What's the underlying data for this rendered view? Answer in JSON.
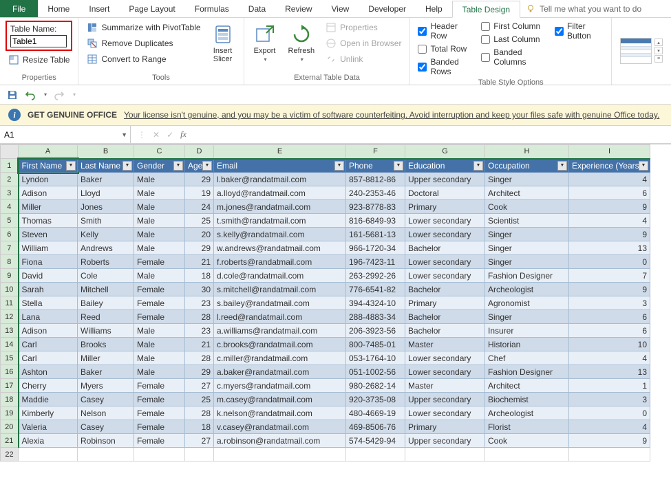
{
  "ribbon": {
    "tabs": [
      "File",
      "Home",
      "Insert",
      "Page Layout",
      "Formulas",
      "Data",
      "Review",
      "View",
      "Developer",
      "Help",
      "Table Design"
    ],
    "active_tab": "Table Design",
    "tellme": "Tell me what you want to do"
  },
  "properties": {
    "label": "Table Name:",
    "value": "Table1",
    "resize": "Resize Table",
    "group_label": "Properties"
  },
  "tools": {
    "pivot": "Summarize with PivotTable",
    "dupes": "Remove Duplicates",
    "convert": "Convert to Range",
    "slicer": "Insert\nSlicer",
    "group_label": "Tools"
  },
  "external": {
    "export": "Export",
    "refresh": "Refresh",
    "props": "Properties",
    "browser": "Open in Browser",
    "unlink": "Unlink",
    "group_label": "External Table Data"
  },
  "styleopts": {
    "header": "Header Row",
    "total": "Total Row",
    "brows": "Banded Rows",
    "fcol": "First Column",
    "lcol": "Last Column",
    "bcols": "Banded Columns",
    "filter": "Filter Button",
    "group_label": "Table Style Options",
    "checked": {
      "header": true,
      "total": false,
      "brows": true,
      "fcol": false,
      "lcol": false,
      "bcols": false,
      "filter": true
    }
  },
  "banner": {
    "title": "GET GENUINE OFFICE",
    "msg": "Your license isn't genuine, and you may be a victim of software counterfeiting. Avoid interruption and keep your files safe with genuine Office today."
  },
  "namebox": "A1",
  "columns": [
    "A",
    "B",
    "C",
    "D",
    "E",
    "F",
    "G",
    "H",
    "I"
  ],
  "table": {
    "headers": [
      "First Name",
      "Last Name",
      "Gender",
      "Age",
      "Email",
      "Phone",
      "Education",
      "Occupation",
      "Experience (Years)"
    ],
    "rows": [
      [
        "Lyndon",
        "Baker",
        "Male",
        "29",
        "l.baker@randatmail.com",
        "857-8812-86",
        "Upper secondary",
        "Singer",
        "4"
      ],
      [
        "Adison",
        "Lloyd",
        "Male",
        "19",
        "a.lloyd@randatmail.com",
        "240-2353-46",
        "Doctoral",
        "Architect",
        "6"
      ],
      [
        "Miller",
        "Jones",
        "Male",
        "24",
        "m.jones@randatmail.com",
        "923-8778-83",
        "Primary",
        "Cook",
        "9"
      ],
      [
        "Thomas",
        "Smith",
        "Male",
        "25",
        "t.smith@randatmail.com",
        "816-6849-93",
        "Lower secondary",
        "Scientist",
        "4"
      ],
      [
        "Steven",
        "Kelly",
        "Male",
        "20",
        "s.kelly@randatmail.com",
        "161-5681-13",
        "Lower secondary",
        "Singer",
        "9"
      ],
      [
        "William",
        "Andrews",
        "Male",
        "29",
        "w.andrews@randatmail.com",
        "966-1720-34",
        "Bachelor",
        "Singer",
        "13"
      ],
      [
        "Fiona",
        "Roberts",
        "Female",
        "21",
        "f.roberts@randatmail.com",
        "196-7423-11",
        "Lower secondary",
        "Singer",
        "0"
      ],
      [
        "David",
        "Cole",
        "Male",
        "18",
        "d.cole@randatmail.com",
        "263-2992-26",
        "Lower secondary",
        "Fashion Designer",
        "7"
      ],
      [
        "Sarah",
        "Mitchell",
        "Female",
        "30",
        "s.mitchell@randatmail.com",
        "776-6541-82",
        "Bachelor",
        "Archeologist",
        "9"
      ],
      [
        "Stella",
        "Bailey",
        "Female",
        "23",
        "s.bailey@randatmail.com",
        "394-4324-10",
        "Primary",
        "Agronomist",
        "3"
      ],
      [
        "Lana",
        "Reed",
        "Female",
        "28",
        "l.reed@randatmail.com",
        "288-4883-34",
        "Bachelor",
        "Singer",
        "6"
      ],
      [
        "Adison",
        "Williams",
        "Male",
        "23",
        "a.williams@randatmail.com",
        "206-3923-56",
        "Bachelor",
        "Insurer",
        "6"
      ],
      [
        "Carl",
        "Brooks",
        "Male",
        "21",
        "c.brooks@randatmail.com",
        "800-7485-01",
        "Master",
        "Historian",
        "10"
      ],
      [
        "Carl",
        "Miller",
        "Male",
        "28",
        "c.miller@randatmail.com",
        "053-1764-10",
        "Lower secondary",
        "Chef",
        "4"
      ],
      [
        "Ashton",
        "Baker",
        "Male",
        "29",
        "a.baker@randatmail.com",
        "051-1002-56",
        "Lower secondary",
        "Fashion Designer",
        "13"
      ],
      [
        "Cherry",
        "Myers",
        "Female",
        "27",
        "c.myers@randatmail.com",
        "980-2682-14",
        "Master",
        "Architect",
        "1"
      ],
      [
        "Maddie",
        "Casey",
        "Female",
        "25",
        "m.casey@randatmail.com",
        "920-3735-08",
        "Upper secondary",
        "Biochemist",
        "3"
      ],
      [
        "Kimberly",
        "Nelson",
        "Female",
        "28",
        "k.nelson@randatmail.com",
        "480-4669-19",
        "Lower secondary",
        "Archeologist",
        "0"
      ],
      [
        "Valeria",
        "Casey",
        "Female",
        "18",
        "v.casey@randatmail.com",
        "469-8506-76",
        "Primary",
        "Florist",
        "4"
      ],
      [
        "Alexia",
        "Robinson",
        "Female",
        "27",
        "a.robinson@randatmail.com",
        "574-5429-94",
        "Upper secondary",
        "Cook",
        "9"
      ]
    ]
  }
}
